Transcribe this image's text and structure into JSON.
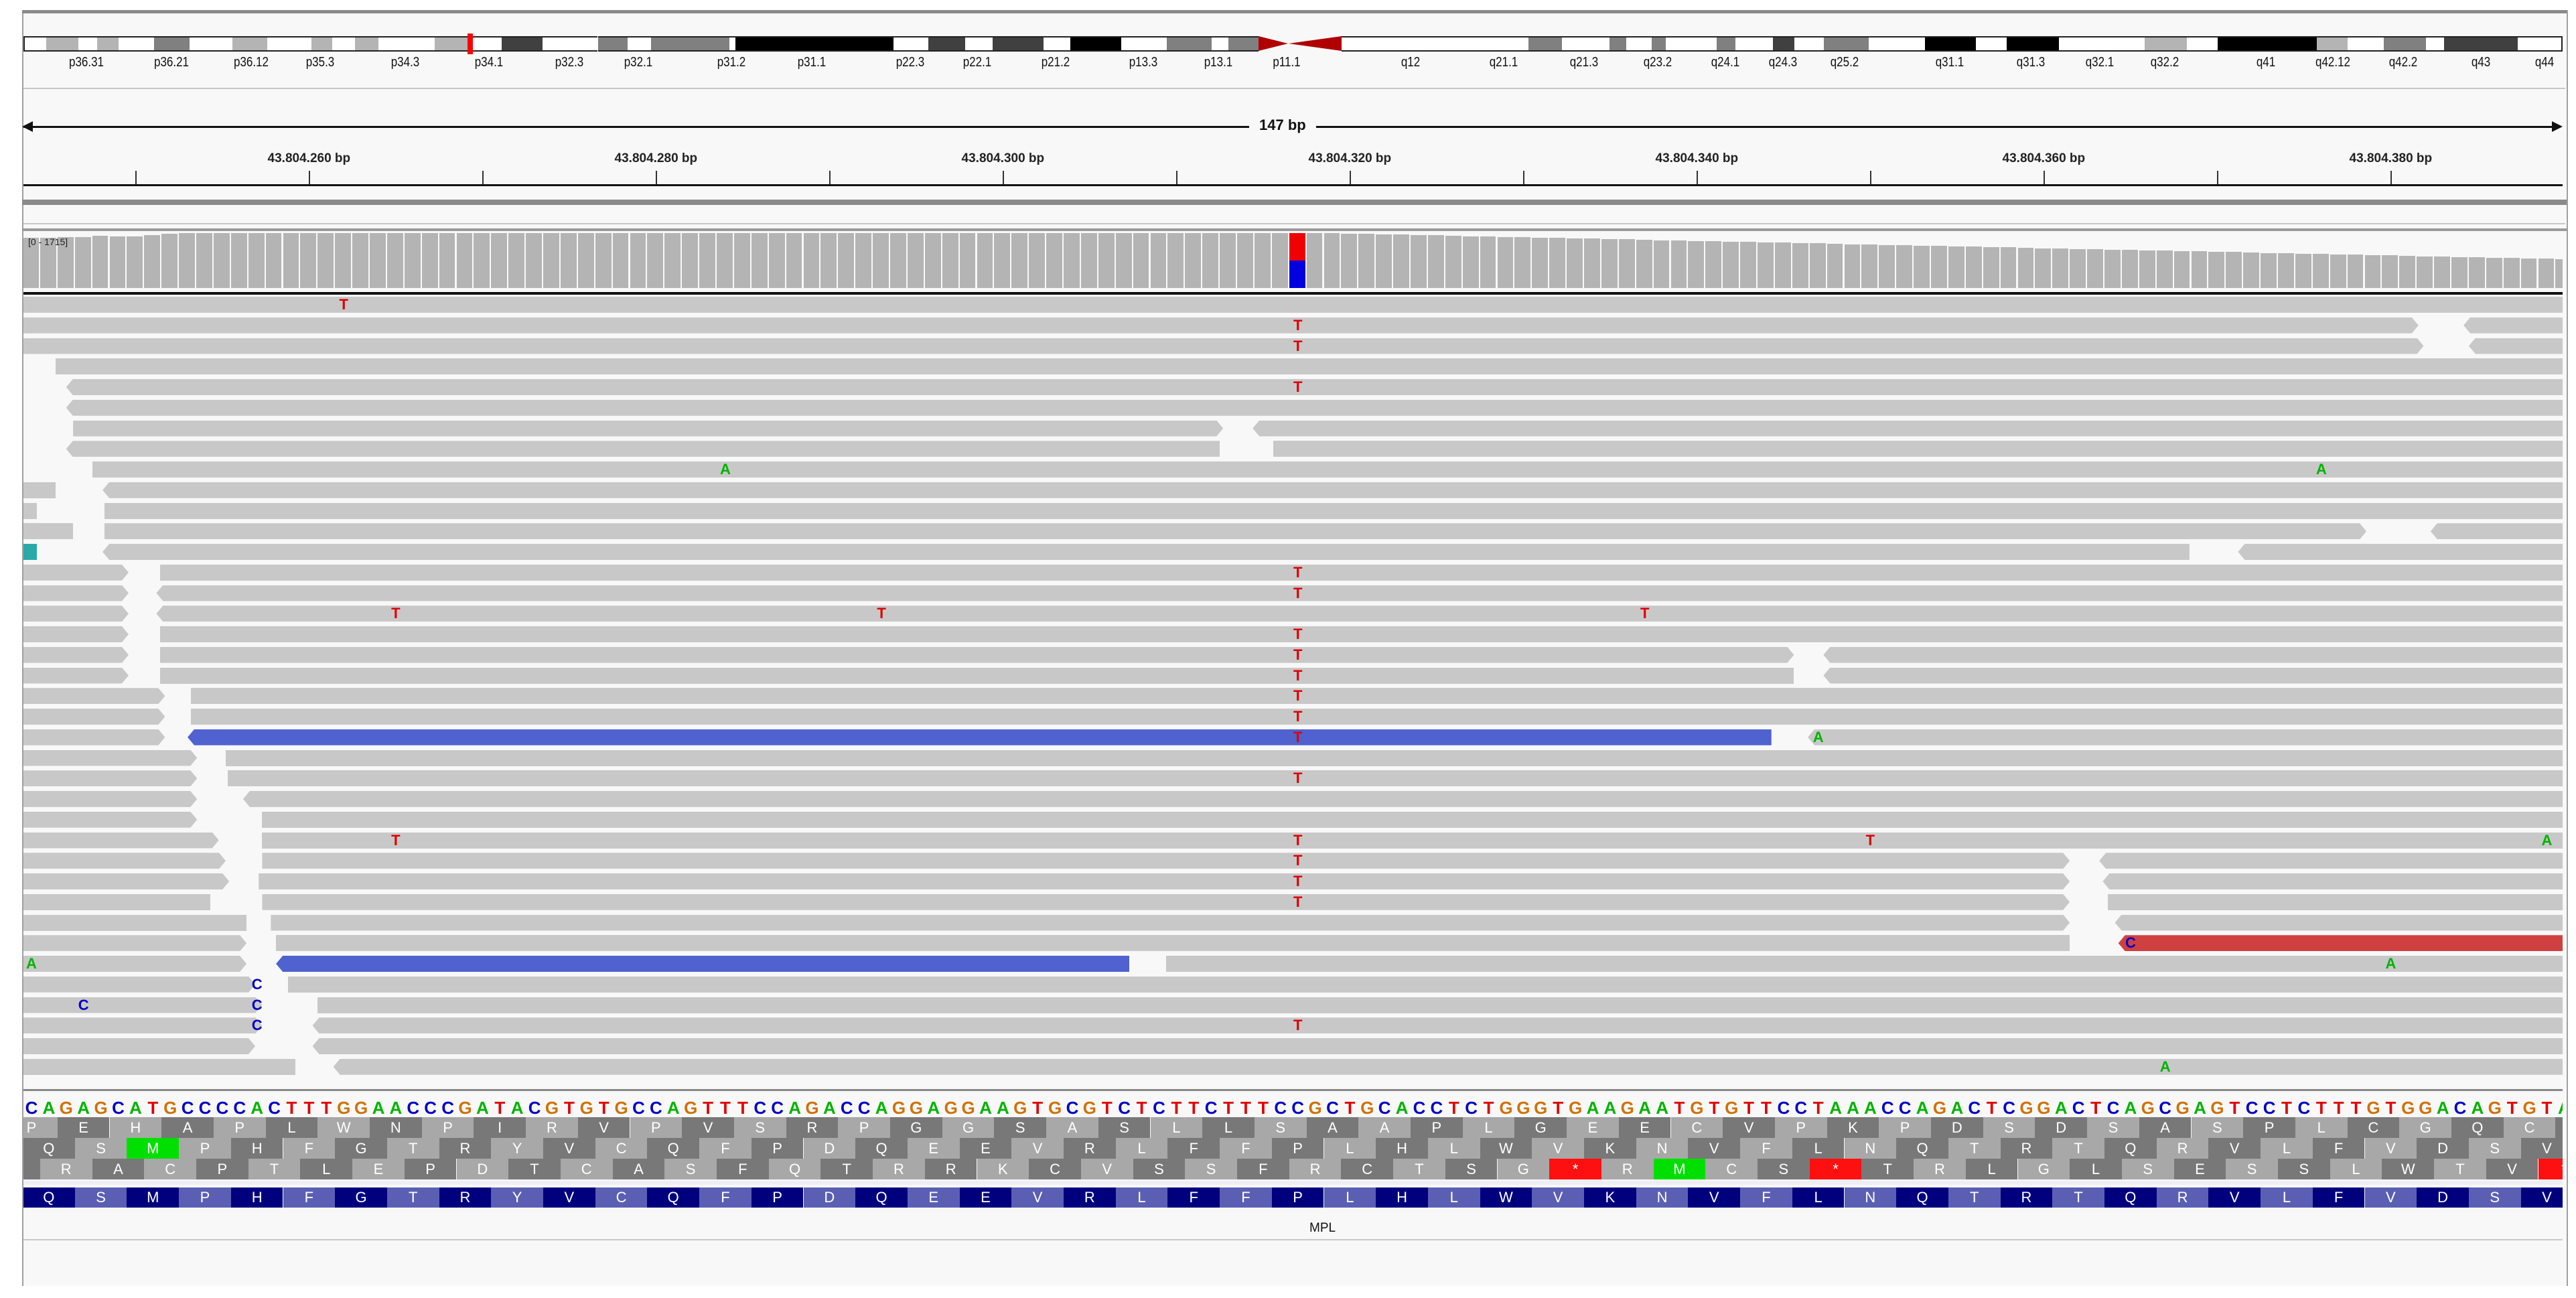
{
  "ideogram": {
    "chromosome_length_mb": 248.9,
    "current_position_mb": 43.8,
    "bands": [
      [
        0,
        2.2,
        "gneg"
      ],
      [
        2.2,
        5.4,
        "gpos25"
      ],
      [
        5.4,
        7.2,
        "gneg"
      ],
      [
        7.2,
        9.3,
        "gpos25"
      ],
      [
        9.3,
        12.8,
        "gneg"
      ],
      [
        12.8,
        16.3,
        "gpos50"
      ],
      [
        16.3,
        20.5,
        "gneg"
      ],
      [
        20.5,
        23.9,
        "gpos25"
      ],
      [
        23.9,
        28.2,
        "gneg"
      ],
      [
        28.2,
        30.3,
        "gpos25"
      ],
      [
        30.3,
        32.5,
        "gneg"
      ],
      [
        32.5,
        34.8,
        "gpos25"
      ],
      [
        34.8,
        40.3,
        "gneg"
      ],
      [
        40.3,
        43.8,
        "gpos25"
      ],
      [
        43.8,
        46.9,
        "gneg"
      ],
      [
        46.9,
        50.9,
        "gpos75"
      ],
      [
        50.9,
        56.3,
        "gneg"
      ],
      [
        56.3,
        59.2,
        "gpos50"
      ],
      [
        59.2,
        61.5,
        "gneg"
      ],
      [
        61.5,
        69.2,
        "gpos50"
      ],
      [
        69.2,
        69.8,
        "gneg"
      ],
      [
        69.8,
        85.3,
        "gpos100"
      ],
      [
        85.3,
        88.7,
        "gneg"
      ],
      [
        88.7,
        92.3,
        "gpos75"
      ],
      [
        92.3,
        95.0,
        "gneg"
      ],
      [
        95.0,
        100.0,
        "gpos75"
      ],
      [
        100.0,
        102.6,
        "gneg"
      ],
      [
        102.6,
        107.6,
        "gpos100"
      ],
      [
        107.6,
        112.1,
        "gneg"
      ],
      [
        112.1,
        116.5,
        "gpos50"
      ],
      [
        116.5,
        118.1,
        "gneg"
      ],
      [
        118.1,
        121.1,
        "gpos50"
      ],
      [
        121.1,
        124.0,
        "acen-p"
      ],
      [
        124.0,
        129.2,
        "acen-q"
      ],
      [
        129.2,
        143.0,
        "gneg"
      ],
      [
        143.0,
        147.5,
        "gneg"
      ],
      [
        147.5,
        150.8,
        "gpos50"
      ],
      [
        150.8,
        155.5,
        "gneg"
      ],
      [
        155.5,
        157.1,
        "gpos50"
      ],
      [
        157.1,
        159.6,
        "gneg"
      ],
      [
        159.6,
        161.0,
        "gpos50"
      ],
      [
        161.0,
        166.0,
        "gneg"
      ],
      [
        166.0,
        167.8,
        "gpos50"
      ],
      [
        167.8,
        171.5,
        "gneg"
      ],
      [
        171.5,
        173.6,
        "gpos75"
      ],
      [
        173.6,
        176.5,
        "gneg"
      ],
      [
        176.5,
        180.9,
        "gpos50"
      ],
      [
        180.9,
        186.4,
        "gneg"
      ],
      [
        186.4,
        191.4,
        "gpos100"
      ],
      [
        191.4,
        194.4,
        "gneg"
      ],
      [
        194.4,
        199.5,
        "gpos100"
      ],
      [
        199.5,
        207.9,
        "gneg"
      ],
      [
        207.9,
        212.1,
        "gpos25"
      ],
      [
        212.1,
        215.1,
        "gneg"
      ],
      [
        215.1,
        224.8,
        "gpos100"
      ],
      [
        224.8,
        227.8,
        "gpos25"
      ],
      [
        227.8,
        231.4,
        "gneg"
      ],
      [
        231.4,
        235.5,
        "gpos50"
      ],
      [
        235.5,
        237.3,
        "gneg"
      ],
      [
        237.3,
        244.5,
        "gpos75"
      ],
      [
        244.5,
        248.9,
        "gneg"
      ]
    ],
    "labels": [
      [
        "p36.31",
        6.2
      ],
      [
        "p36.21",
        14.5
      ],
      [
        "p36.12",
        22.3
      ],
      [
        "p35.3",
        29.1
      ],
      [
        "p34.3",
        37.4
      ],
      [
        "p34.1",
        45.6
      ],
      [
        "p32.3",
        53.5
      ],
      [
        "p32.1",
        60.3
      ],
      [
        "p31.2",
        69.4
      ],
      [
        "p31.1",
        77.3
      ],
      [
        "p22.3",
        86.9
      ],
      [
        "p22.1",
        93.5
      ],
      [
        "p21.2",
        101.2
      ],
      [
        "p13.3",
        109.8
      ],
      [
        "p13.1",
        117.1
      ],
      [
        "p11.1",
        123.8
      ],
      [
        "q12",
        136.0
      ],
      [
        "q21.1",
        145.1
      ],
      [
        "q21.3",
        153.0
      ],
      [
        "q23.2",
        160.2
      ],
      [
        "q24.1",
        166.8
      ],
      [
        "q24.3",
        172.5
      ],
      [
        "q25.2",
        178.5
      ],
      [
        "q31.1",
        188.8
      ],
      [
        "q31.3",
        196.8
      ],
      [
        "q32.1",
        203.5
      ],
      [
        "q32.2",
        209.9
      ],
      [
        "q41",
        219.8
      ],
      [
        "q42.12",
        226.4
      ],
      [
        "q42.2",
        233.3
      ],
      [
        "q43",
        240.9
      ],
      [
        "q44",
        247.1
      ]
    ],
    "stain_colors": {
      "gneg": "#ffffff",
      "gpos25": "#b4b4b4",
      "gpos50": "#808080",
      "gpos75": "#404040",
      "gpos100": "#000000",
      "acen": "#b00000",
      "marker": "#ff0000"
    }
  },
  "ruler": {
    "span_label": "147 bp",
    "view_start": 43804244,
    "view_length": 147,
    "minor_ticks": [
      43804250,
      43804270,
      43804290,
      43804310,
      43804330,
      43804350,
      43804370
    ],
    "ticks": [
      {
        "pos": 43804260,
        "label": "43.804.260 bp"
      },
      {
        "pos": 43804280,
        "label": "43.804.280 bp"
      },
      {
        "pos": 43804300,
        "label": "43.804.300 bp"
      },
      {
        "pos": 43804320,
        "label": "43.804.320 bp"
      },
      {
        "pos": 43804340,
        "label": "43.804.340 bp"
      },
      {
        "pos": 43804360,
        "label": "43.804.360 bp"
      },
      {
        "pos": 43804380,
        "label": "43.804.380 bp"
      }
    ]
  },
  "coverage": {
    "range_label": "[0 - 1715]",
    "max": 1715,
    "values": [
      1560,
      1560,
      1580,
      1590,
      1630,
      1610,
      1610,
      1650,
      1700,
      1705,
      1710,
      1712,
      1715,
      1715,
      1715,
      1715,
      1715,
      1715,
      1715,
      1715,
      1715,
      1715,
      1715,
      1715,
      1715,
      1715,
      1715,
      1715,
      1715,
      1715,
      1715,
      1715,
      1715,
      1715,
      1715,
      1715,
      1715,
      1715,
      1715,
      1715,
      1715,
      1715,
      1715,
      1715,
      1715,
      1715,
      1715,
      1715,
      1715,
      1715,
      1715,
      1715,
      1715,
      1715,
      1715,
      1715,
      1715,
      1715,
      1715,
      1715,
      1715,
      1715,
      1715,
      1715,
      1715,
      1715,
      1715,
      1715,
      1715,
      1715,
      1712,
      1712,
      1710,
      1710,
      1708,
      1705,
      1700,
      1689,
      1677,
      1666,
      1654,
      1643,
      1632,
      1620,
      1609,
      1597,
      1586,
      1575,
      1563,
      1552,
      1540,
      1529,
      1518,
      1506,
      1495,
      1483,
      1472,
      1461,
      1449,
      1438,
      1426,
      1415,
      1404,
      1392,
      1381,
      1369,
      1358,
      1347,
      1335,
      1324,
      1312,
      1301,
      1290,
      1278,
      1267,
      1255,
      1244,
      1233,
      1221,
      1210,
      1198,
      1187,
      1176,
      1164,
      1153,
      1141,
      1130,
      1119,
      1107,
      1096,
      1084,
      1073,
      1062,
      1050,
      1039,
      1027,
      1016,
      1005,
      993,
      982,
      970,
      959,
      948,
      936,
      925,
      913,
      902
    ],
    "variant_site": {
      "index": 73,
      "alleles": [
        {
          "base": "T",
          "fraction": 0.5
        },
        {
          "base": "C",
          "fraction": 0.5
        }
      ]
    }
  },
  "colors": {
    "read": "#c8c8c8",
    "read_blue": "#4f62cf",
    "read_red": "#d04040",
    "read_teal": "#2aa9a9",
    "A": "#00b400",
    "C": "#0000c8",
    "G": "#d17105",
    "T": "#e00000",
    "frame_light": "#a8a8a8",
    "frame_dark": "#787878",
    "start_codon": "#00e000",
    "stop_codon": "#ff1010",
    "gene_dark": "#00007f",
    "gene_light": "#5b5fb3"
  },
  "reads": [
    {
      "segs": [
        [
          0,
          148
        ]
      ],
      "mm": [
        [
          18,
          "T"
        ]
      ]
    },
    {
      "segs": [
        [
          0,
          138.1,
          "g",
          "r"
        ],
        [
          140.7,
          148,
          "g",
          "l"
        ]
      ],
      "mm": [
        [
          73,
          "T"
        ]
      ]
    },
    {
      "segs": [
        [
          0,
          138.4,
          "g",
          "r"
        ],
        [
          141,
          148,
          "g",
          "l"
        ]
      ],
      "mm": [
        [
          73,
          "T"
        ]
      ]
    },
    {
      "segs": [
        [
          1.9,
          148
        ]
      ],
      "mm": []
    },
    {
      "segs": [
        [
          2.5,
          148,
          "g",
          "l"
        ]
      ],
      "mm": [
        [
          73,
          "T"
        ]
      ]
    },
    {
      "segs": [
        [
          2.5,
          148,
          "g",
          "l"
        ]
      ],
      "mm": []
    },
    {
      "segs": [
        [
          2.9,
          69.2,
          "g",
          "r"
        ],
        [
          70.9,
          148,
          "g",
          "l"
        ]
      ],
      "mm": []
    },
    {
      "segs": [
        [
          2.5,
          69.0,
          "g",
          "l"
        ],
        [
          72.1,
          148
        ]
      ],
      "mm": []
    },
    {
      "segs": [
        [
          4.0,
          148
        ]
      ],
      "mm": [
        [
          40,
          "A"
        ],
        [
          132,
          "A"
        ]
      ]
    },
    {
      "segs": [
        [
          0,
          1.9
        ],
        [
          4.6,
          148,
          "g",
          "l"
        ]
      ],
      "mm": []
    },
    {
      "segs": [
        [
          0,
          0.8
        ],
        [
          4.7,
          148
        ]
      ],
      "mm": []
    },
    {
      "segs": [
        [
          0,
          2.9
        ],
        [
          4.7,
          135.1,
          "g",
          "r"
        ],
        [
          138.8,
          148,
          "g",
          "l"
        ]
      ],
      "mm": []
    },
    {
      "segs": [
        [
          0,
          0.8,
          "t"
        ],
        [
          4.6,
          124.9,
          "g",
          "l"
        ],
        [
          127.7,
          148,
          "g",
          "l"
        ]
      ],
      "mm": []
    },
    {
      "segs": [
        [
          0,
          6.1,
          "g",
          "r"
        ],
        [
          7.9,
          148
        ]
      ],
      "mm": [
        [
          73,
          "T"
        ]
      ]
    },
    {
      "segs": [
        [
          0,
          6.1,
          "g",
          "r"
        ],
        [
          7.7,
          148,
          "g",
          "l"
        ]
      ],
      "mm": [
        [
          73,
          "T"
        ]
      ]
    },
    {
      "segs": [
        [
          0,
          6.1,
          "g",
          "r"
        ],
        [
          7.7,
          148,
          "g",
          "l"
        ]
      ],
      "mm": [
        [
          21,
          "T"
        ],
        [
          49,
          "T"
        ],
        [
          93,
          "T"
        ]
      ]
    },
    {
      "segs": [
        [
          0,
          6.1,
          "g",
          "r"
        ],
        [
          7.9,
          148
        ]
      ],
      "mm": [
        [
          73,
          "T"
        ]
      ]
    },
    {
      "segs": [
        [
          0,
          6.1,
          "g",
          "r"
        ],
        [
          7.9,
          102.1,
          "g",
          "r"
        ],
        [
          103.8,
          148,
          "g",
          "l"
        ]
      ],
      "mm": [
        [
          73,
          "T"
        ]
      ]
    },
    {
      "segs": [
        [
          0,
          6.1,
          "g",
          "r"
        ],
        [
          7.9,
          102.1
        ],
        [
          103.8,
          148,
          "g",
          "l"
        ]
      ],
      "mm": [
        [
          73,
          "T"
        ]
      ]
    },
    {
      "segs": [
        [
          0,
          8.2,
          "g",
          "r"
        ],
        [
          9.7,
          148
        ]
      ],
      "mm": [
        [
          73,
          "T"
        ]
      ]
    },
    {
      "segs": [
        [
          0,
          8.2,
          "g",
          "r"
        ],
        [
          9.7,
          148
        ]
      ],
      "mm": [
        [
          73,
          "T"
        ]
      ]
    },
    {
      "segs": [
        [
          0,
          8.2,
          "g",
          "r"
        ],
        [
          9.5,
          100.8,
          "b",
          "l"
        ],
        [
          102.9,
          148,
          "g",
          "l"
        ]
      ],
      "mm": [
        [
          73,
          "T"
        ],
        [
          103,
          "A"
        ]
      ]
    },
    {
      "segs": [
        [
          0,
          10.05,
          "g",
          "r"
        ],
        [
          11.7,
          148
        ]
      ],
      "mm": []
    },
    {
      "segs": [
        [
          0,
          10.05,
          "g",
          "r"
        ],
        [
          11.8,
          148
        ]
      ],
      "mm": [
        [
          73,
          "T"
        ]
      ]
    },
    {
      "segs": [
        [
          0,
          10.05,
          "g",
          "r"
        ],
        [
          12.7,
          148,
          "g",
          "l"
        ]
      ],
      "mm": []
    },
    {
      "segs": [
        [
          0,
          10.05,
          "g",
          "r"
        ],
        [
          13.8,
          148
        ]
      ],
      "mm": []
    },
    {
      "segs": [
        [
          0,
          11.3,
          "g",
          "r"
        ],
        [
          13.8,
          148
        ]
      ],
      "mm": [
        [
          21,
          "T"
        ],
        [
          73,
          "T"
        ],
        [
          106,
          "T"
        ],
        [
          145,
          "A"
        ]
      ]
    },
    {
      "segs": [
        [
          0,
          11.7,
          "g",
          "r"
        ],
        [
          13.8,
          118.0,
          "g",
          "r"
        ],
        [
          119.7,
          148,
          "g",
          "l"
        ]
      ],
      "mm": [
        [
          73,
          "T"
        ]
      ]
    },
    {
      "segs": [
        [
          0,
          11.9,
          "g",
          "r"
        ],
        [
          13.6,
          118.0,
          "g",
          "r"
        ],
        [
          119.9,
          148,
          "g",
          "l"
        ]
      ],
      "mm": [
        [
          73,
          "T"
        ]
      ]
    },
    {
      "segs": [
        [
          0,
          10.8
        ],
        [
          13.8,
          118.0,
          "g",
          "r"
        ],
        [
          120.2,
          148
        ]
      ],
      "mm": [
        [
          73,
          "T"
        ]
      ]
    },
    {
      "segs": [
        [
          0,
          12.9
        ],
        [
          14.3,
          118.0,
          "g",
          "r"
        ],
        [
          120.6,
          148,
          "g",
          "l"
        ]
      ],
      "mm": []
    },
    {
      "segs": [
        [
          0,
          12.9,
          "g",
          "r"
        ],
        [
          14.6,
          118.0
        ],
        [
          120.8,
          148,
          "r",
          "l"
        ]
      ],
      "mm": [
        [
          121,
          "C"
        ]
      ]
    },
    {
      "segs": [
        [
          0,
          12.9,
          "g",
          "r"
        ],
        [
          14.6,
          63.8,
          "b",
          "l"
        ],
        [
          65.9,
          148
        ]
      ],
      "mm": [
        [
          0,
          "A"
        ],
        [
          136,
          "A"
        ]
      ]
    },
    {
      "segs": [
        [
          0,
          13.4,
          "g",
          "r"
        ],
        [
          15.3,
          148
        ]
      ],
      "mm": [
        [
          13,
          "C"
        ]
      ]
    },
    {
      "segs": [
        [
          0,
          13.8,
          "g",
          "r"
        ],
        [
          17.0,
          148
        ]
      ],
      "mm": [
        [
          3,
          "C"
        ],
        [
          13,
          "C"
        ]
      ]
    },
    {
      "segs": [
        [
          0,
          13.8,
          "g",
          "r"
        ],
        [
          16.7,
          148,
          "g",
          "l"
        ]
      ],
      "mm": [
        [
          13,
          "C"
        ],
        [
          73,
          "T"
        ]
      ]
    },
    {
      "segs": [
        [
          0,
          13.4,
          "g",
          "r"
        ],
        [
          16.7,
          148,
          "g",
          "l"
        ]
      ],
      "mm": []
    },
    {
      "segs": [
        [
          0,
          15.7
        ],
        [
          17.9,
          148,
          "g",
          "l"
        ]
      ],
      "mm": [
        [
          123,
          "A"
        ]
      ]
    }
  ],
  "reference": {
    "sequence": "CAGAGCATGCCCCACTTTGGAACCCGATACGTGTGCCAGTTTCCAGACCAGGAGGAAGTGCGTCTCTTCTTTCCGCTGCACCTCTGGGTGAAGAATGTGTTCCTAAACCAGACTCGGACTCAGCGAGTCCTCTTTGTGGACAGTGTA"
  },
  "translation": {
    "frames": [
      {
        "offset": -1,
        "aa": "PEHAPLWNPIRVPVSRPGGSASLLSAAPLGEECVPKPDSDSASPLCGQC"
      },
      {
        "offset": 0,
        "aa": "QSMPHFGTRYVCQFPDQEEVRLFFPLHLWVKNVFLNQTRTQRVLFVDSV"
      },
      {
        "offset": 1,
        "aa": "RACPTLEPDTCASFQTRRKCVSSFRCTSG*RMCS*TRLGLSESSLWTV*"
      }
    ]
  },
  "gene": {
    "name": "MPL",
    "aa": "QSMPHFGTRYVCQFPDQEEVRLFFPLHLWVKNVFLNQTRTQRVLFVDSV"
  }
}
